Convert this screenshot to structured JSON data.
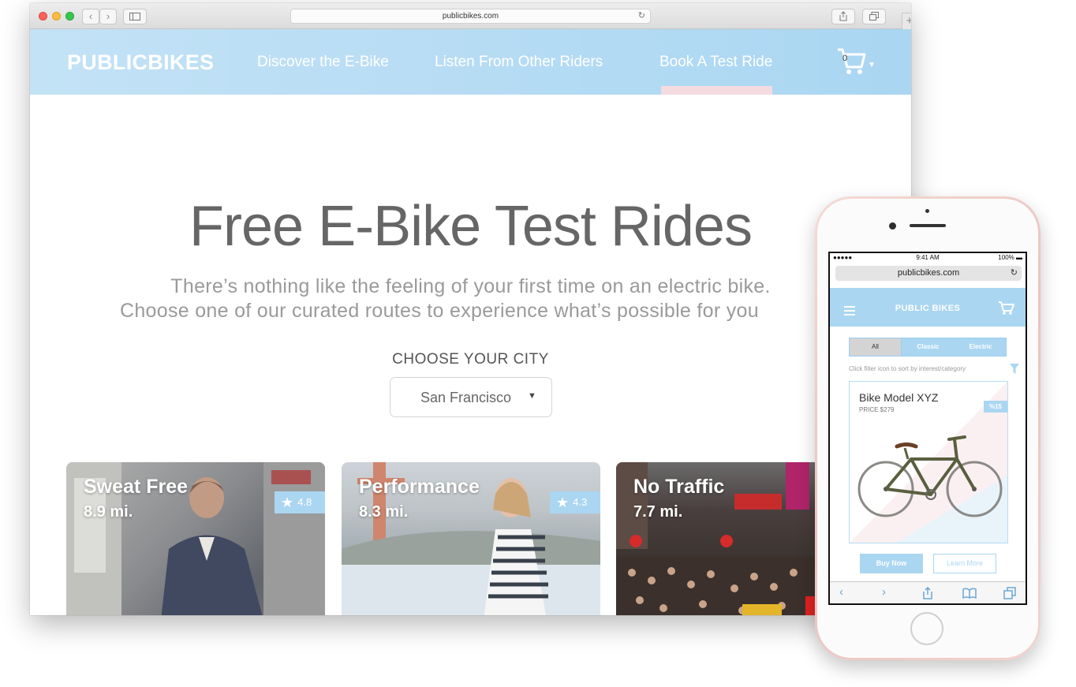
{
  "browser": {
    "url": "publicbikes.com",
    "site": {
      "logo": "PUBLICBIKES",
      "nav": [
        "Discover the E-Bike",
        "Listen From Other Riders",
        "Book A Test Ride"
      ],
      "cart_count": "0"
    },
    "hero": {
      "title": "Free E-Bike Test Rides",
      "subtitle_line1": "There’s nothing like the feeling of your first time on an electric bike.",
      "subtitle_line2": "Choose one of our curated routes to experience what’s possible for you"
    },
    "city": {
      "label": "CHOOSE YOUR CITY",
      "selected": "San Francisco"
    },
    "routes": [
      {
        "title": "Sweat Free",
        "distance": "8.9 mi.",
        "rating": "4.8"
      },
      {
        "title": "Performance",
        "distance": "8.3 mi.",
        "rating": "4.3"
      },
      {
        "title": "No Traffic",
        "distance": "7.7 mi."
      }
    ]
  },
  "phone": {
    "status": {
      "carrier": "●●●●● ",
      "time": "9:41 AM",
      "battery": "100%"
    },
    "url": "publicbikes.com",
    "header_title": "PUBLIC BIKES",
    "tabs": [
      "All",
      "Classic",
      "Electric"
    ],
    "filter_hint": "Click filter icon to sort by interest/category",
    "product": {
      "name": "Bike Model XYZ",
      "price": "PRICE $279",
      "discount": "%15"
    },
    "buy_label": "Buy Now",
    "learn_label": "Learn More"
  },
  "colors": {
    "accent_blue": "#aad6f2",
    "active_underline": "#f4dbe0",
    "phone_rose_gold": "#ecc7c3"
  }
}
